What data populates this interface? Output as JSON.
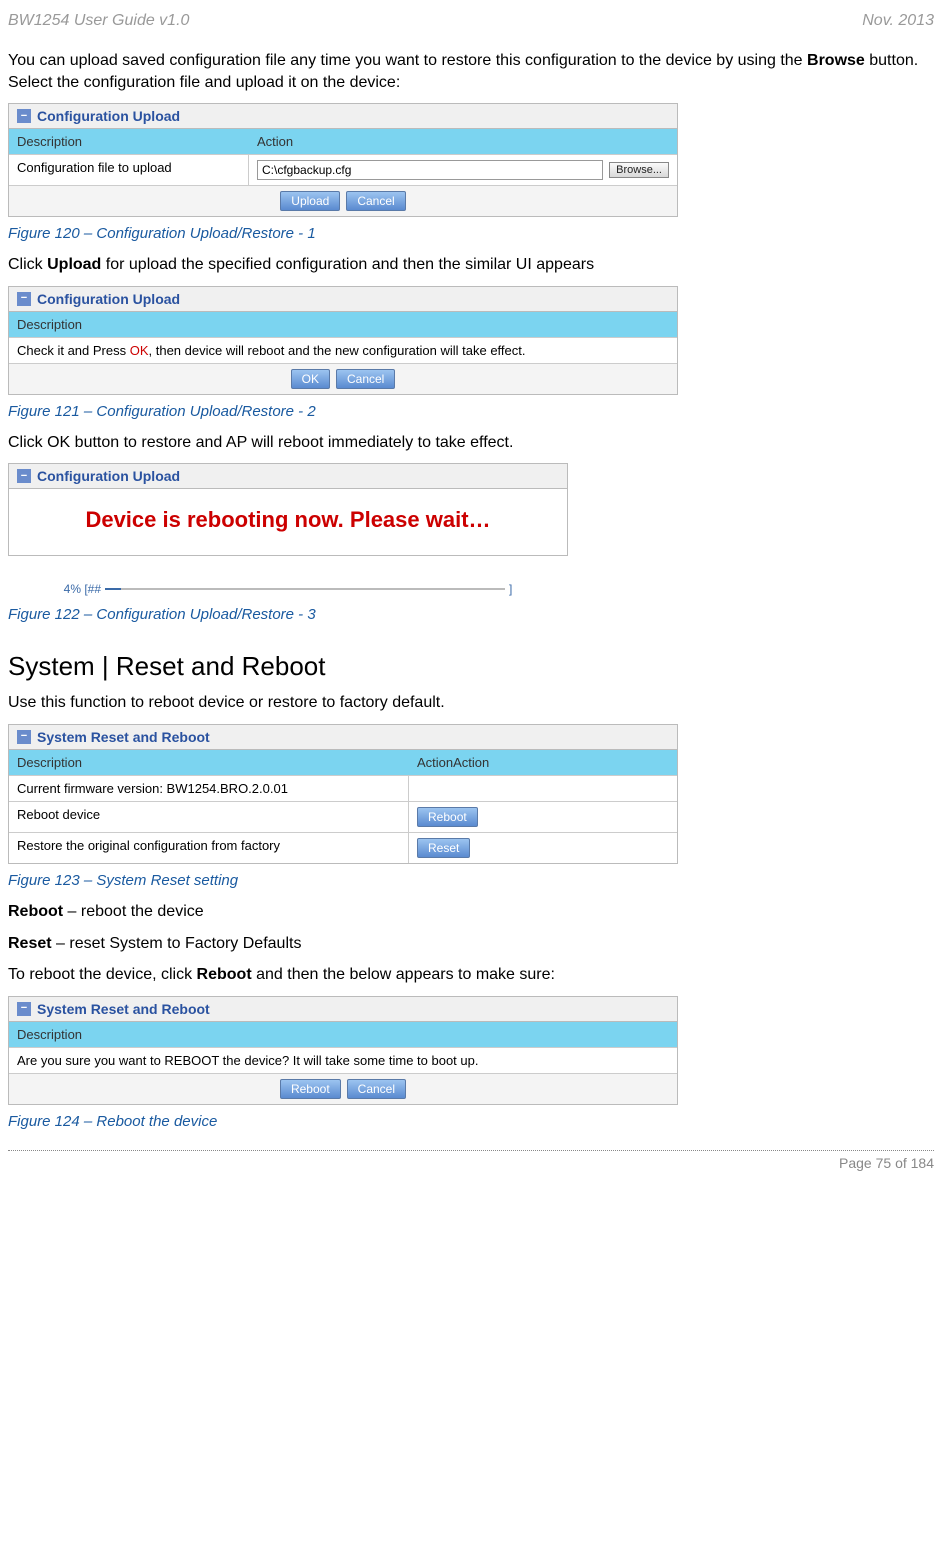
{
  "header": {
    "left": "BW1254 User Guide v1.0",
    "right": "Nov.  2013"
  },
  "intro1_a": "You can upload saved configuration file any time you want to restore this configuration to the device by using the ",
  "intro1_bold": "Browse",
  "intro1_b": " button. Select the configuration file and upload it on the device:",
  "panel1": {
    "title": "Configuration Upload",
    "th1": "Description",
    "th2": "Action",
    "row_label": "Configuration file to upload",
    "input_value": "C:\\cfgbackup.cfg",
    "browse_label": "Browse...",
    "upload_label": "Upload",
    "cancel_label": "Cancel"
  },
  "caption1": "Figure 120 – Configuration Upload/Restore - 1",
  "intro2_a": "Click ",
  "intro2_bold": "Upload",
  "intro2_b": " for upload the specified configuration and then the similar UI appears",
  "panel2": {
    "title": "Configuration Upload",
    "th1": "Description",
    "msg_a": "Check it and Press ",
    "msg_ok": "OK",
    "msg_b": ", then device will reboot and the new configuration will take effect.",
    "ok_label": "OK",
    "cancel_label": "Cancel"
  },
  "caption2": "Figure 121 – Configuration Upload/Restore - 2",
  "intro3": "Click OK button to restore and AP will reboot immediately to take effect.",
  "panel3": {
    "title": "Configuration Upload",
    "reboot_msg": "Device is rebooting now. Please wait…",
    "progress_label": "4% [##",
    "progress_end": "]"
  },
  "caption3": "Figure 122 – Configuration Upload/Restore - 3",
  "section_title": "System | Reset and Reboot",
  "section_intro": "Use this function to reboot device or restore to factory default.",
  "panel4": {
    "title": "System Reset and Reboot",
    "th1": "Description",
    "th2": "ActionAction",
    "row1": "Current firmware version: BW1254.BRO.2.0.01",
    "row2": "Reboot device",
    "row3": "Restore the original configuration from factory",
    "reboot_label": "Reboot",
    "reset_label": "Reset"
  },
  "caption4": "Figure 123 – System Reset setting",
  "reboot_a": "Reboot",
  "reboot_b": " – reboot the device",
  "reset_a": "Reset",
  "reset_b": " – reset System to Factory Defaults",
  "intro5_a": "To reboot the device, click ",
  "intro5_bold": "Reboot",
  "intro5_b": " and then the below appears to make sure:",
  "panel5": {
    "title": "System Reset and Reboot",
    "th1": "Description",
    "msg": "Are you sure you want to REBOOT the device? It will take some time to boot up.",
    "reboot_label": "Reboot",
    "cancel_label": "Cancel"
  },
  "caption5": "Figure 124 – Reboot the device",
  "footer": "Page 75 of 184"
}
